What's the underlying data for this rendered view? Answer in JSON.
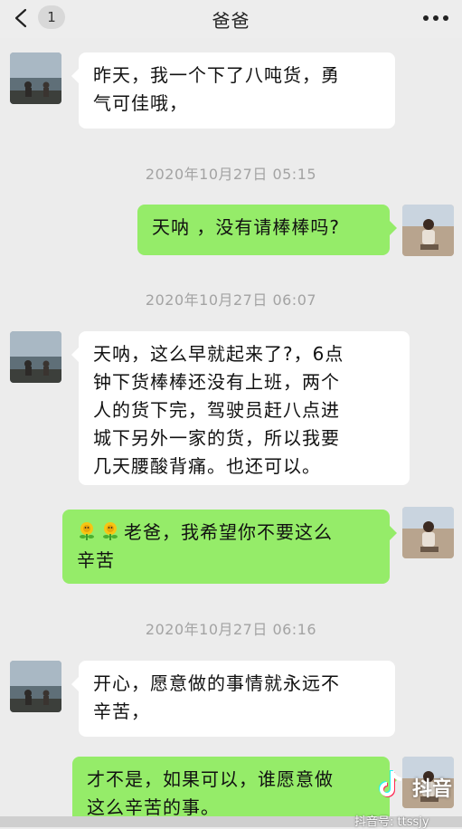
{
  "header": {
    "title": "爸爸",
    "unread_badge": "1"
  },
  "messages": [
    {
      "side": "left",
      "text": "昨天，我一个下了八吨货，勇\n气可佳哦，"
    },
    {
      "type": "time",
      "text": "2020年10月27日 05:15"
    },
    {
      "side": "right",
      "text": "天呐 ，没有请棒棒吗?"
    },
    {
      "type": "time",
      "text": "2020年10月27日 06:07"
    },
    {
      "side": "left",
      "text": "天呐，这么早就起来了?，6点\n钟下货棒棒还没有上班，两个\n人的货下完，驾驶员赶八点进\n城下另外一家的货，所以我要\n几天腰酸背痛。也还可以。"
    },
    {
      "side": "right",
      "text": "老爸，我希望你不要这么\n辛苦",
      "emoji": "sunflower-emoji"
    },
    {
      "type": "time",
      "text": "2020年10月27日 06:16"
    },
    {
      "side": "left",
      "text": "开心，愿意做的事情就永远不\n辛苦，"
    },
    {
      "side": "right",
      "text": "才不是，如果可以，谁愿意做\n这么辛苦的事。"
    }
  ],
  "watermark": {
    "brand": "抖音",
    "account_id": "抖音号: ttssjy"
  },
  "colors": {
    "background": "#ececec",
    "bubble_self": "#95ec69",
    "bubble_other": "#ffffff",
    "timestamp": "#a3a3a3"
  }
}
